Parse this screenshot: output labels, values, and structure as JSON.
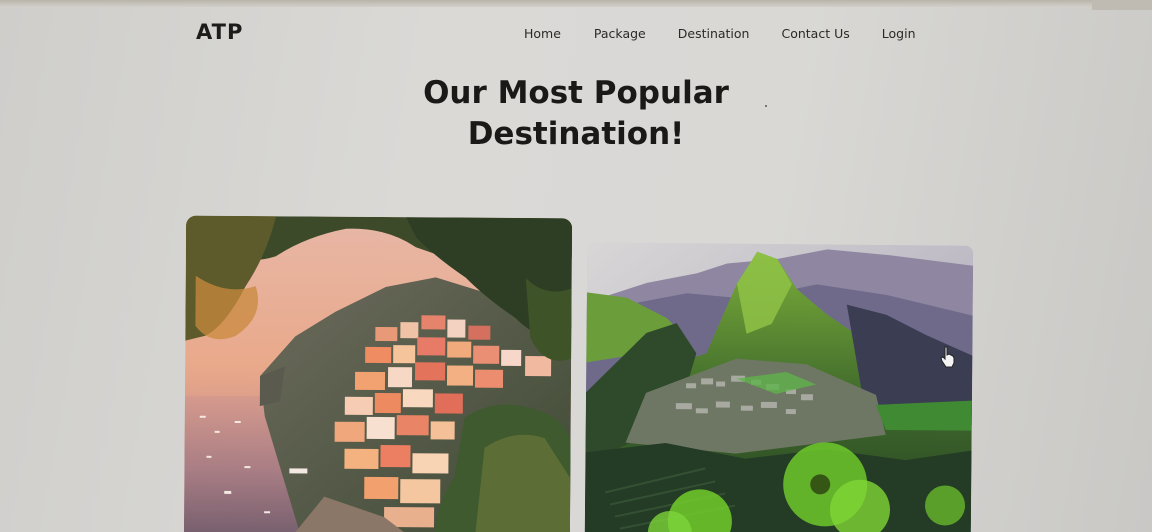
{
  "brand": "ATP",
  "nav": {
    "home": "Home",
    "package": "Package",
    "destination": "Destination",
    "contact": "Contact Us",
    "login": "Login"
  },
  "hero": {
    "title_line1": "Our Most Popular",
    "title_line2": "Destination!"
  },
  "cards": [
    {
      "image": "coastal-cliff-village-photo"
    },
    {
      "image": "mountain-ruins-photo"
    }
  ],
  "colors": {
    "page_bg": "#d7d6d3",
    "text": "#1a1918"
  }
}
